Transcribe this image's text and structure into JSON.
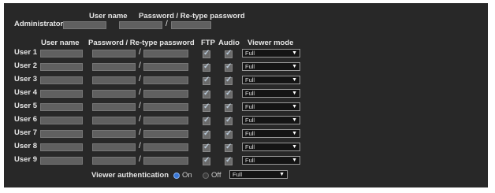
{
  "admin": {
    "label": "Administrator",
    "username_header": "User name",
    "password_header": "Password / Re-type password",
    "slash": "/"
  },
  "users_header": {
    "username": "User name",
    "password": "Password / Re-type password",
    "ftp": "FTP",
    "audio": "Audio",
    "viewer_mode": "Viewer mode"
  },
  "users": [
    {
      "label": "User 1",
      "ftp": true,
      "audio": true,
      "viewer_mode": "Full"
    },
    {
      "label": "User 2",
      "ftp": true,
      "audio": true,
      "viewer_mode": "Full"
    },
    {
      "label": "User 3",
      "ftp": true,
      "audio": true,
      "viewer_mode": "Full"
    },
    {
      "label": "User 4",
      "ftp": true,
      "audio": true,
      "viewer_mode": "Full"
    },
    {
      "label": "User 5",
      "ftp": true,
      "audio": true,
      "viewer_mode": "Full"
    },
    {
      "label": "User 6",
      "ftp": true,
      "audio": true,
      "viewer_mode": "Full"
    },
    {
      "label": "User 7",
      "ftp": true,
      "audio": true,
      "viewer_mode": "Full"
    },
    {
      "label": "User 8",
      "ftp": true,
      "audio": true,
      "viewer_mode": "Full"
    },
    {
      "label": "User 9",
      "ftp": true,
      "audio": true,
      "viewer_mode": "Full"
    }
  ],
  "viewer_auth": {
    "label": "Viewer authentication",
    "on_label": "On",
    "off_label": "Off",
    "selected": "On",
    "mode": "Full"
  },
  "colors": {
    "panel": "#282828",
    "field": "#606060",
    "radio_on": "#3a78d8"
  }
}
